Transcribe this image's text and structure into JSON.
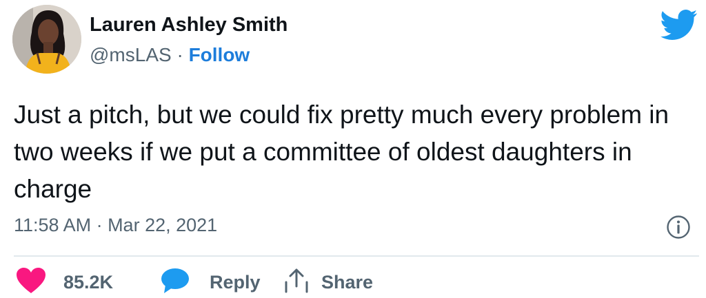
{
  "user": {
    "name": "Lauren Ashley Smith",
    "handle": "@msLAS",
    "separator": "·",
    "follow_label": "Follow"
  },
  "tweet": {
    "text": "Just a pitch, but we could fix pretty much every problem in two weeks if we put a committee of oldest daughters in charge",
    "timestamp": "11:58 AM · Mar 22, 2021"
  },
  "actions": {
    "likes_count": "85.2K",
    "reply_label": "Reply",
    "share_label": "Share"
  },
  "icons": {
    "logo": "twitter-bird-icon",
    "info": "info-icon",
    "like": "heart-icon",
    "reply": "speech-bubble-icon",
    "share": "share-arrow-icon"
  },
  "colors": {
    "brand": "#1d9bf0",
    "follow": "#1d7ddb",
    "like": "#f91880",
    "secondary_text": "#536471",
    "divider": "#e1e8ed"
  }
}
